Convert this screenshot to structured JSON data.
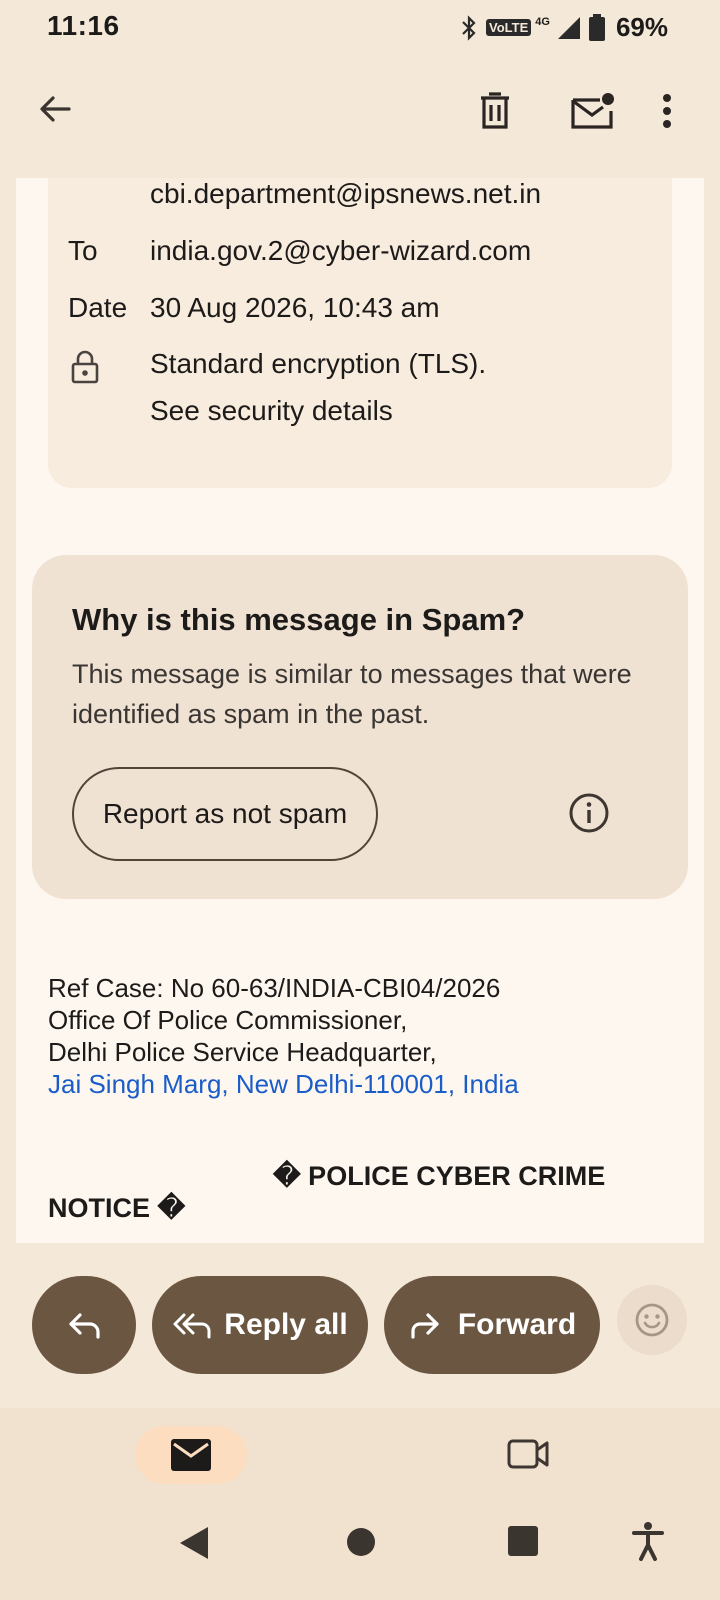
{
  "status_bar": {
    "time": "11:16",
    "volte": "VoLTE",
    "network": "4G",
    "battery": "69%"
  },
  "app_bar": {
    "icons": [
      "back-arrow-icon",
      "delete-icon",
      "mark-unread-icon",
      "more-vert-icon"
    ]
  },
  "email_header": {
    "from_partial": "cbi.department@ipsnews.net.in",
    "to_label": "To",
    "to_value": "india.gov.2@cyber-wizard.com",
    "date_label": "Date",
    "date_value": "30 Aug 2026, 10:43 am",
    "encryption": "Standard encryption (TLS).",
    "security_link": "See security details"
  },
  "spam_notice": {
    "title": "Why is this message in Spam?",
    "body": "This message is similar to messages that were identified as spam in the past.",
    "report_button": "Report as not spam"
  },
  "message_body": {
    "line1": "Ref Case: No 60-63/INDIA-CBI04/2026",
    "line2": "Office Of Police Commissioner,",
    "line3": "Delhi Police Service Headquarter,",
    "address_link": "Jai Singh Marg, New Delhi-110001, India",
    "notice_part1": "� POLICE CYBER CRIME",
    "notice_part2": "NOTICE �"
  },
  "actions": {
    "reply_all": "Reply all",
    "forward": "Forward"
  },
  "colors": {
    "background": "#f4e8d8",
    "content": "#fdf7f0",
    "spam_card": "#f0e2d3",
    "pill": "#6b5641",
    "link": "#1a5dc8",
    "nav_active": "#fcddc0"
  }
}
